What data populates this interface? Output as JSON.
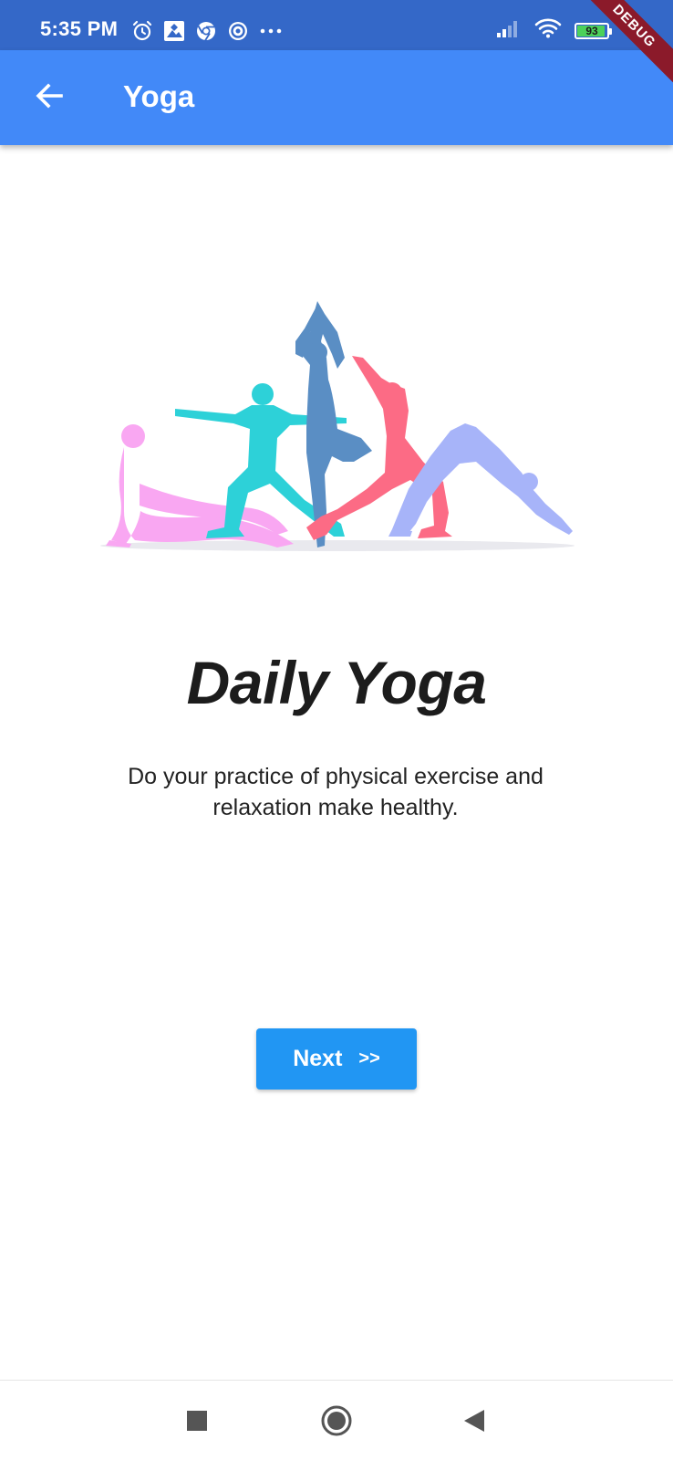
{
  "status_bar": {
    "time": "5:35 PM",
    "battery_level": "93",
    "left_icons": [
      "alarm-icon",
      "photos-icon",
      "chrome-icon",
      "at-sign-icon",
      "more-dots-icon"
    ],
    "right_icons": [
      "signal-icon",
      "wifi-icon",
      "battery-icon"
    ]
  },
  "debug_banner": "DEBUG",
  "app_bar": {
    "title": "Yoga",
    "back_icon": "arrow-back-icon"
  },
  "hero": {
    "icon": "yoga-poses-illustration",
    "figure_colors": [
      "#f9a7f2",
      "#2dd1d8",
      "#5a8ec4",
      "#fc6b85",
      "#a7b4f9"
    ]
  },
  "content": {
    "headline": "Daily Yoga",
    "description": "Do your practice of physical exercise and relaxation make healthy."
  },
  "next_button": {
    "label": "Next",
    "arrows": ">>",
    "color": "#2196f3"
  },
  "nav_bar": {
    "items": [
      "recents-square-icon",
      "home-circle-icon",
      "back-triangle-icon"
    ]
  },
  "colors": {
    "status_bar": "#3468c8",
    "app_bar": "#4289f8",
    "accent": "#2196f3"
  }
}
